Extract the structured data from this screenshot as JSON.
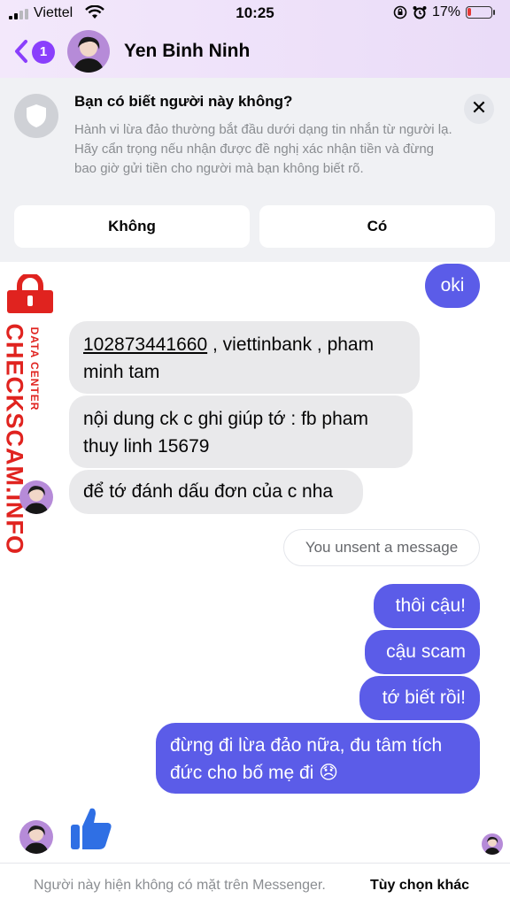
{
  "status_bar": {
    "carrier": "Viettel",
    "time": "10:25",
    "battery": "17%",
    "battery_level": 0.17,
    "icons": [
      "signal-icon",
      "wifi-icon",
      "rotation-lock-icon",
      "alarm-icon",
      "battery-icon"
    ]
  },
  "header": {
    "back_badge": "1",
    "contact_name": "Yen Binh Ninh",
    "accent": "#8a3ffc"
  },
  "safety_notice": {
    "title": "Bạn có biết người này không?",
    "body": "Hành vi lừa đảo thường bắt đầu dưới dạng tin nhắn từ người lạ. Hãy cẩn trọng nếu nhận được đề nghị xác nhận tiền và đừng bao giờ gửi tiền cho người mà bạn không biết rõ.",
    "no_label": "Không",
    "yes_label": "Có"
  },
  "messages": {
    "oki": "oki",
    "account_number": "102873441660",
    "account_rest": ", viettinbank , pham minh tam",
    "transfer_note": "nội dung ck c ghi giúp tớ : fb pham thuy linh 15679",
    "mark_order": "để tớ đánh dấu đơn của c nha",
    "unsent": "You unsent a message",
    "thoi_cau": "thôi cậu!",
    "cau_scam": "cậu scam",
    "to_biet_roi": "tớ biết rồi!",
    "dung_lua_dao": "đừng đi lừa đảo nữa, đu tâm tích đức cho bố mẹ đi 😞"
  },
  "footer": {
    "status_text": "Người này hiện không có mặt trên Messenger.",
    "more_options": "Tùy chọn khác"
  },
  "watermark": {
    "main": "CHECKSCAM.INFO",
    "sub": "DATA CENTER"
  },
  "colors": {
    "outgoing_bubble": "#5b5ce8",
    "incoming_bubble": "#e9e9eb",
    "watermark": "#e0231f",
    "like": "#2f6fe4"
  }
}
